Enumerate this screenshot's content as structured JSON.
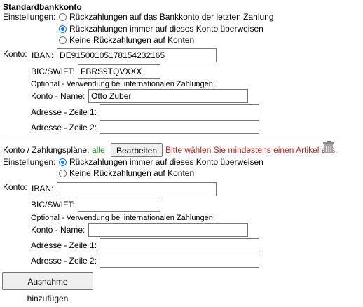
{
  "section1": {
    "title": "Standardbankkonto",
    "settings_label": "Einstellungen:",
    "options": [
      {
        "label": "Rückzahlungen auf das Bankkonto der letzten Zahlung",
        "checked": false
      },
      {
        "label": "Rückzahlungen immer auf dieses Konto überweisen",
        "checked": true
      },
      {
        "label": "Keine Rückzahlungen auf Konten",
        "checked": false
      }
    ],
    "konto_label": "Konto:",
    "iban_label": "IBAN:",
    "iban_value": "DE91500105178154232165",
    "bic_label": "BIC/SWIFT:",
    "bic_value": "FBRS9TQVXXX",
    "optional_note": "Optional - Verwendung bei internationalen Zahlungen:",
    "name_label": "Konto - Name:",
    "name_value": "Otto Zuber",
    "addr1_label": "Adresse - Zeile 1:",
    "addr1_value": "",
    "addr2_label": "Adresse - Zeile 2:",
    "addr2_value": ""
  },
  "section2": {
    "plans_label": "Konto / Zahlungspläne:",
    "plans_value": "alle",
    "edit_button": "Bearbeiten",
    "warning": "Bitte wählen Sie mindestens einen Artikel aus.",
    "settings_label": "Einstellungen:",
    "options": [
      {
        "label": "Rückzahlungen immer auf dieses Konto überweisen",
        "checked": true
      },
      {
        "label": "Keine Rückzahlungen auf Konten",
        "checked": false
      }
    ],
    "konto_label": "Konto:",
    "iban_label": "IBAN:",
    "iban_value": "",
    "bic_label": "BIC/SWIFT:",
    "bic_value": "",
    "optional_note": "Optional - Verwendung bei internationalen Zahlungen:",
    "name_label": "Konto - Name:",
    "name_value": "",
    "addr1_label": "Adresse - Zeile 1:",
    "addr1_value": "",
    "addr2_label": "Adresse - Zeile 2:",
    "addr2_value": ""
  },
  "add_exception_button": "Ausnahme hinzufügen",
  "colors": {
    "accent": "#0075ff",
    "green_text": "#1a8c1a",
    "warning_text": "#b3261e"
  }
}
